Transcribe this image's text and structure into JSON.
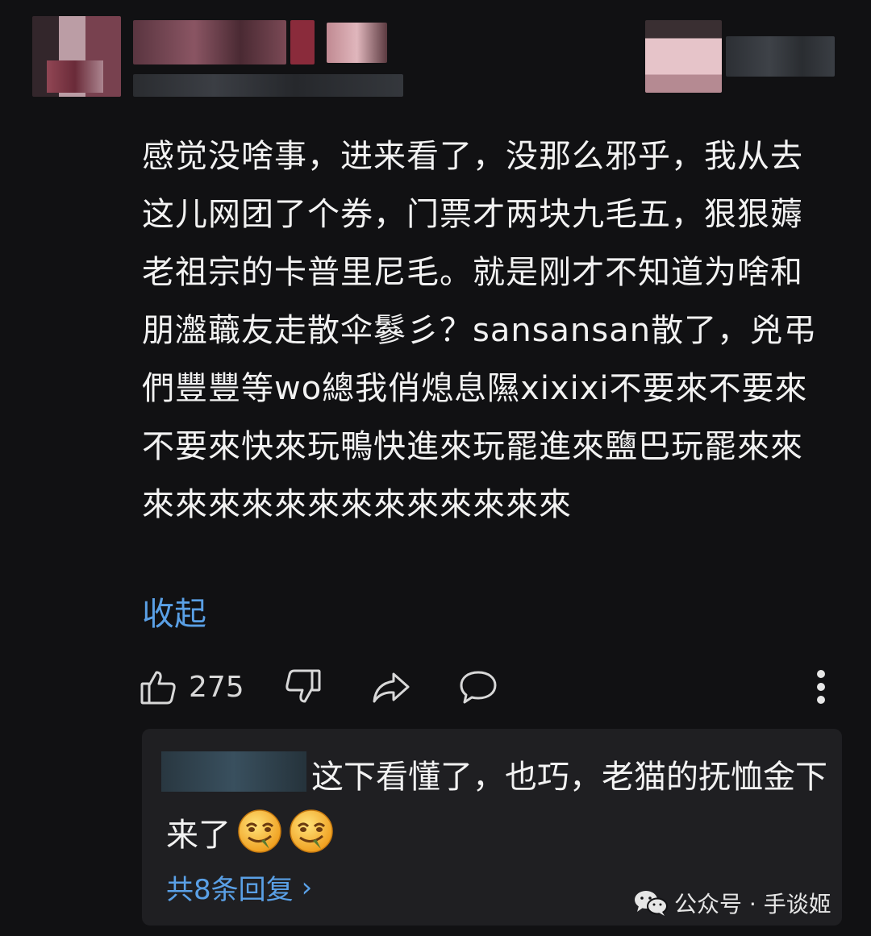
{
  "header": {
    "left_avatar_icon": "avatar-pixelated",
    "right_avatar_icon": "avatar-pixelated"
  },
  "comment": {
    "text": "感觉没啥事，进来看了，没那么邪乎，我从去这儿网团了个券，门票才两块九毛五，狠狠薅老祖宗的卡普里尼毛。就是刚才不知道为啥和朋瀊蘵友走散伞鬖彡？sansansan散了，兇弔們豐豐等wo總我俏熄息隰xixixi不要來不要來不要來快來玩鴨快進來玩罷進來鹽巴玩罷來來來來來來來來來來來來來來來",
    "collapse_label": "收起",
    "accent_color": "#5aa0e6"
  },
  "actions": {
    "like_icon": "thumbs-up-icon",
    "like_count": "275",
    "dislike_icon": "thumbs-down-icon",
    "share_icon": "share-icon",
    "reply_icon": "comment-bubble-icon",
    "more_icon": "more-vertical-icon"
  },
  "reply": {
    "text": "这下看懂了，也巧，老猫的抚恤金下来了",
    "emoji_icon": "smirk-emoji-icon",
    "more_replies_label": "共8条回复",
    "more_replies_chevron": "›"
  },
  "watermark": {
    "icon": "wechat-icon",
    "text": "公众号 · 手谈姬"
  }
}
